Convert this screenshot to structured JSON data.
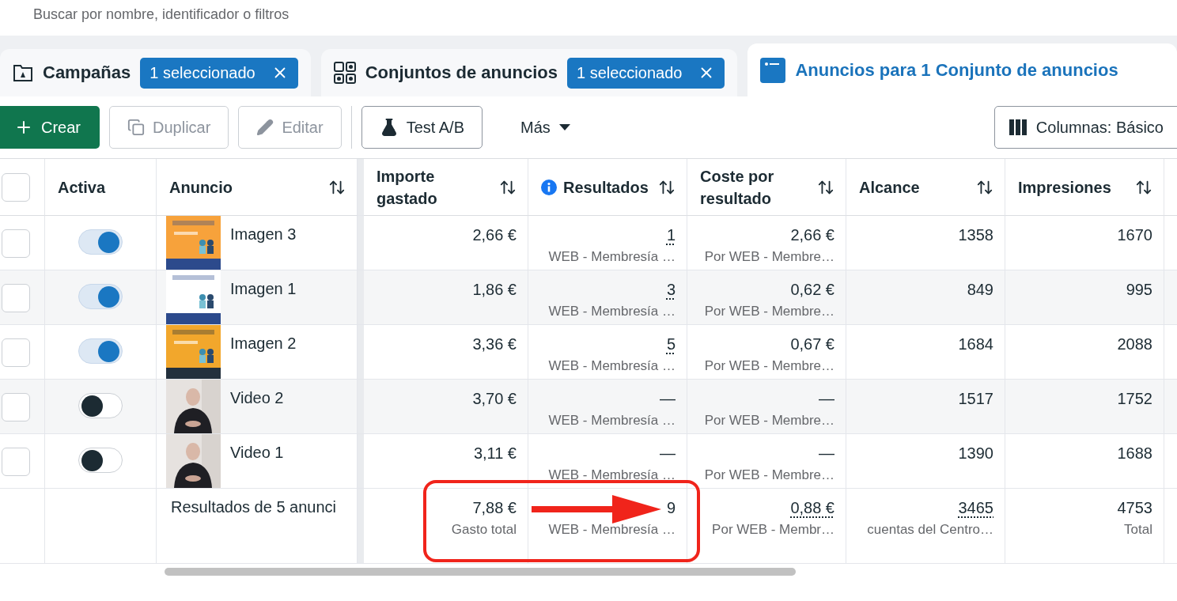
{
  "search": {
    "placeholder": "Buscar por nombre, identificador o filtros"
  },
  "tabs": [
    {
      "kind": "campaigns",
      "label": "Campañas",
      "badge": "1 seleccionado",
      "selected": false
    },
    {
      "kind": "adsets",
      "label": "Conjuntos de anuncios",
      "badge": "1 seleccionado",
      "selected": false
    },
    {
      "kind": "ads",
      "label": "Anuncios para 1 Conjunto de anuncios",
      "selected": true
    }
  ],
  "toolbar": [
    {
      "kind": "create",
      "label": "Crear",
      "disabled": false
    },
    {
      "kind": "duplicate",
      "label": "Duplicar",
      "disabled": true
    },
    {
      "kind": "edit",
      "label": "Editar",
      "disabled": true
    },
    {
      "kind": "divider"
    },
    {
      "kind": "test",
      "label": "Test A/B",
      "disabled": false
    },
    {
      "kind": "more",
      "label": "Más",
      "disabled": false
    }
  ],
  "columns_button": {
    "label": "Columnas: Básico"
  },
  "table": {
    "columns": [
      {
        "kind": "check",
        "checked": false
      },
      {
        "kind": "toggle",
        "label": "Activa"
      },
      {
        "kind": "text",
        "label": "Anuncio"
      },
      {
        "kind": "num",
        "label": "Importe gastado"
      },
      {
        "kind": "metric",
        "label": "Resultados"
      },
      {
        "kind": "num",
        "label": "Coste por resultado"
      },
      {
        "kind": "num",
        "label": "Alcance"
      },
      {
        "kind": "num",
        "label": "Impresiones"
      }
    ],
    "rows": [
      {
        "checked": false,
        "active": true,
        "name": "Imagen 3",
        "spend": "2,66 €",
        "results": {
          "value": "1",
          "underlined": true,
          "note": "WEB - Membresía …"
        },
        "cost": {
          "value": "2,66 €",
          "note": "Por WEB - Membre…"
        },
        "reach": "1358",
        "impressions": "1670"
      },
      {
        "checked": false,
        "active": true,
        "name": "Imagen 1",
        "spend": "1,86 €",
        "results": {
          "value": "3",
          "underlined": true,
          "note": "WEB - Membresía …"
        },
        "cost": {
          "value": "0,62 €",
          "note": "Por WEB - Membre…"
        },
        "reach": "849",
        "impressions": "995"
      },
      {
        "checked": false,
        "active": true,
        "name": "Imagen 2",
        "spend": "3,36 €",
        "results": {
          "value": "5",
          "underlined": true,
          "note": "WEB - Membresía …"
        },
        "cost": {
          "value": "0,67 €",
          "note": "Por WEB - Membre…"
        },
        "reach": "1684",
        "impressions": "2088"
      },
      {
        "checked": false,
        "active": false,
        "name": "Video 2",
        "spend": "3,70 €",
        "results": {
          "value": "—",
          "underlined": false,
          "note": "WEB - Membresía …"
        },
        "cost": {
          "value": "—",
          "note": "Por WEB - Membre…"
        },
        "reach": "1517",
        "impressions": "1752"
      },
      {
        "checked": false,
        "active": false,
        "name": "Video 1",
        "spend": "3,11 €",
        "results": {
          "value": "—",
          "underlined": false,
          "note": "WEB - Membresía …"
        },
        "cost": {
          "value": "—",
          "note": "Por WEB - Membre…"
        },
        "reach": "1390",
        "impressions": "1688"
      }
    ],
    "footer": {
      "label": "Resultados de 5 anunci",
      "cells": [
        {
          "value": "7,88 €",
          "underlined": false,
          "note": "Gasto total"
        },
        {
          "value": "9",
          "underlined": false,
          "note": "WEB - Membresía …"
        },
        {
          "value": "0,88 €",
          "underlined": true,
          "note": "Por WEB - Membr…"
        },
        {
          "value": "3465",
          "underlined": true,
          "note": "cuentas del Centro…"
        },
        {
          "value": "4753",
          "underlined": false,
          "note": "Total"
        }
      ]
    }
  },
  "annotation": {
    "kind": "callout"
  }
}
